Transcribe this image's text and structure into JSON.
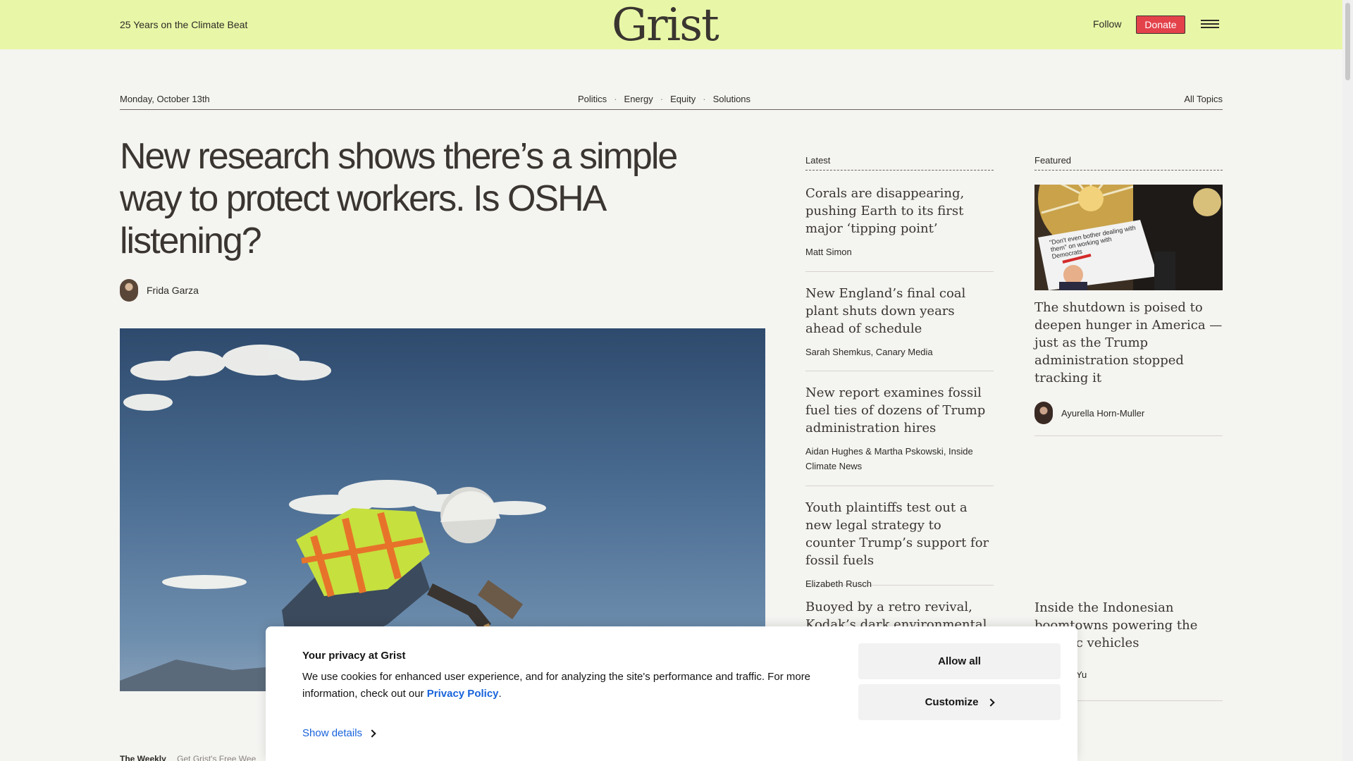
{
  "header": {
    "tagline": "25 Years on the Climate Beat",
    "logo": "Grist",
    "follow_label": "Follow",
    "donate_label": "Donate",
    "brand_color": "#e8f7a7",
    "donate_color": "#e3424b"
  },
  "nav": {
    "date": "Monday, October 13th",
    "topics": [
      "Politics",
      "Energy",
      "Equity",
      "Solutions"
    ],
    "separator": "·",
    "all_topics": "All Topics"
  },
  "article": {
    "headline": "New research shows there’s a simple way to protect workers. Is OSHA listening?",
    "author": "Frida Garza"
  },
  "latest": {
    "heading": "Latest",
    "items": [
      {
        "title": "Corals are disappearing, pushing Earth to its first major ‘tipping point’",
        "byline": "Matt Simon"
      },
      {
        "title": "New England’s final coal plant shuts down years ahead of schedule",
        "byline": "Sarah Shemkus, Canary Media"
      },
      {
        "title": "New report examines fossil fuel ties of dozens of Trump administration hires",
        "byline": "Aidan Hughes & Martha Pskowski, Inside Climate News"
      },
      {
        "title": "Youth plaintiffs test out a new legal strategy to counter Trump’s support for fossil fuels",
        "byline": "Elizabeth Rusch"
      },
      {
        "title": "Buoyed by a retro revival, Kodak’s dark environmental",
        "byline": ""
      }
    ]
  },
  "featured": {
    "heading": "Featured",
    "image_sign_text": "\"Don't even bother dealing with them\" on working with Democrats",
    "items": [
      {
        "title": "The shutdown is poised to deepen hunger in America — just as the Trump administration stopped tracking it",
        "byline": "Ayurella Horn-Muller"
      },
      {
        "title": "Inside the Indonesian boomtowns powering the electric vehicles",
        "byline": "fei Yu"
      }
    ]
  },
  "newsletter": {
    "label": "The Weekly",
    "text": "Get Grist's Free Wee"
  },
  "cookie": {
    "title": "Your privacy at Grist",
    "text_before": "We use cookies for enhanced user experience, and for analyzing the site's performance and traffic. For more information, check out our ",
    "link": "Privacy Policy",
    "text_after": ".",
    "show_details": "Show details",
    "allow_all": "Allow all",
    "customize": "Customize",
    "link_color": "#1863dc"
  }
}
